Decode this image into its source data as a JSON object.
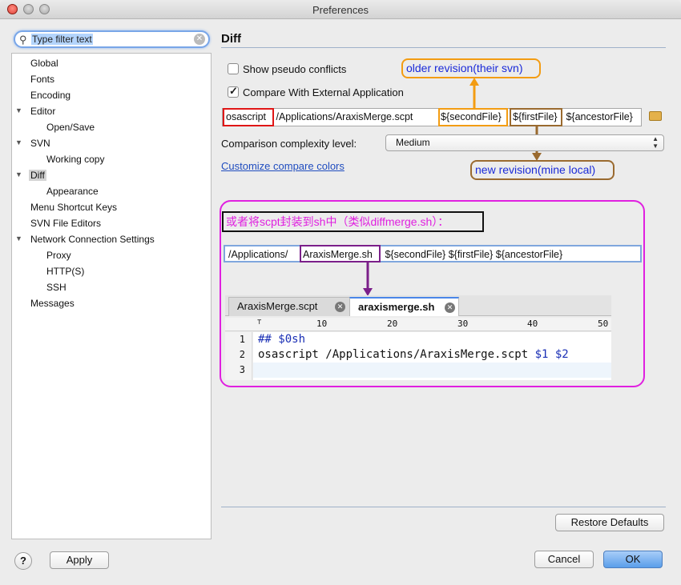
{
  "window": {
    "title": "Preferences"
  },
  "filter": {
    "placeholder": "Type filter text",
    "value": "Type filter text"
  },
  "tree": [
    {
      "label": "Global"
    },
    {
      "label": "Fonts"
    },
    {
      "label": "Encoding"
    },
    {
      "label": "Editor"
    },
    {
      "label": "Open/Save"
    },
    {
      "label": "SVN"
    },
    {
      "label": "Working copy"
    },
    {
      "label": "Diff"
    },
    {
      "label": "Appearance"
    },
    {
      "label": "Menu Shortcut Keys"
    },
    {
      "label": "SVN File Editors"
    },
    {
      "label": "Network Connection Settings"
    },
    {
      "label": "Proxy"
    },
    {
      "label": "HTTP(S)"
    },
    {
      "label": "SSH"
    },
    {
      "label": "Messages"
    }
  ],
  "diff": {
    "title": "Diff",
    "show_pseudo_conflicts": {
      "label": "Show pseudo conflicts",
      "checked": false
    },
    "compare_external": {
      "label": "Compare With External Application",
      "checked": true
    },
    "command": {
      "seg1": "osascript",
      "seg2": " /Applications/AraxisMerge.scpt ",
      "seg3": "${secondFile}",
      "seg4": " ",
      "seg5": "${firstFile}",
      "seg6": " ${ancestorFile}"
    },
    "complexity_label": "Comparison complexity level:",
    "complexity_value": "Medium",
    "customize_link": "Customize compare colors"
  },
  "annotations": {
    "older": "older revision(their svn)",
    "newer": "new revision(mine local)",
    "cn_note": "或者将scpt封装到sh中（类似diffmerge.sh）：",
    "sh_field_pre": "/Applications/",
    "sh_field_mid": "AraxisMerge.sh",
    "sh_field_post": " ${secondFile} ${firstFile} ${ancestorFile}"
  },
  "editor": {
    "tabs": [
      {
        "label": "AraxisMerge.scpt",
        "active": false
      },
      {
        "label": "araxismerge.sh",
        "active": true
      }
    ],
    "ruler": [
      "10",
      "20",
      "30",
      "40",
      "50"
    ],
    "line_numbers": [
      "1",
      "2",
      "3"
    ],
    "line1": "## $0sh",
    "line2_pre": "osascript /Applications/AraxisMerge.scpt ",
    "line2_a": "$1",
    "line2_b": "$2"
  },
  "buttons": {
    "restore": "Restore Defaults",
    "apply": "Apply",
    "cancel": "Cancel",
    "ok": "OK",
    "help": "?"
  },
  "colors": {
    "accent_blue": "#4a86e8",
    "annotation_orange": "#f39c12",
    "annotation_brown": "#9a6a2f",
    "annotation_magenta": "#e020e0",
    "annotation_red": "#e01616",
    "annotation_purple": "#7b1f8a"
  }
}
